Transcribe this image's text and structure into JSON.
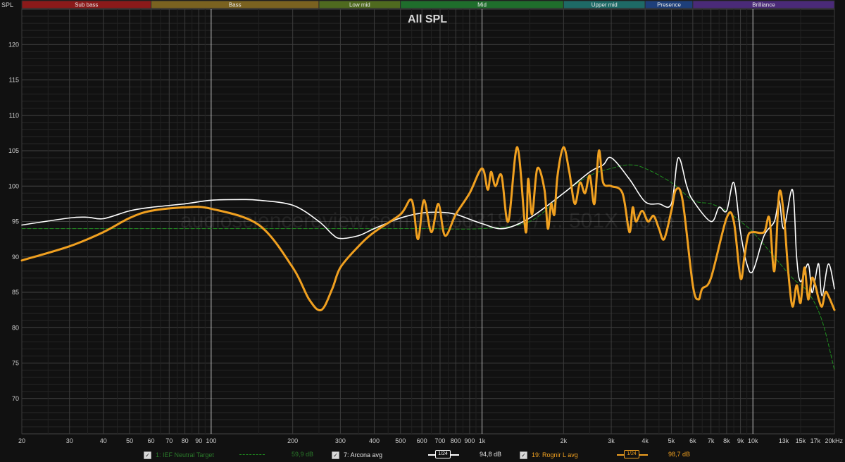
{
  "chart_data": {
    "type": "line",
    "title": "All SPL",
    "ylabel": "SPL",
    "xlim": [
      20,
      20000
    ],
    "ylim": [
      65,
      125
    ],
    "x_scale": "log",
    "grid": true,
    "watermark": "audiosciencereview.com IEC60318-4 / ... 501X clone",
    "bands": [
      {
        "name": "Sub bass",
        "from": 20,
        "to": 60,
        "color": "#8b1a1a"
      },
      {
        "name": "Bass",
        "from": 60,
        "to": 250,
        "color": "#7a6220"
      },
      {
        "name": "Low mid",
        "from": 250,
        "to": 500,
        "color": "#4f6a1f"
      },
      {
        "name": "Mid",
        "from": 500,
        "to": 2000,
        "color": "#1f6e2c"
      },
      {
        "name": "Upper mid",
        "from": 2000,
        "to": 4000,
        "color": "#1e6a66"
      },
      {
        "name": "Presence",
        "from": 4000,
        "to": 6000,
        "color": "#1e3f7a"
      },
      {
        "name": "Brilliance",
        "from": 6000,
        "to": 20000,
        "color": "#4a2a78"
      }
    ],
    "y_ticks": [
      70,
      75,
      80,
      85,
      90,
      95,
      100,
      105,
      110,
      115,
      120
    ],
    "x_ticks": [
      {
        "v": 20,
        "label": "20"
      },
      {
        "v": 30,
        "label": "30"
      },
      {
        "v": 40,
        "label": "40"
      },
      {
        "v": 50,
        "label": "50"
      },
      {
        "v": 60,
        "label": "60"
      },
      {
        "v": 70,
        "label": "70"
      },
      {
        "v": 80,
        "label": "80"
      },
      {
        "v": 90,
        "label": "90"
      },
      {
        "v": 100,
        "label": "100"
      },
      {
        "v": 200,
        "label": "200"
      },
      {
        "v": 300,
        "label": "300"
      },
      {
        "v": 400,
        "label": "400"
      },
      {
        "v": 500,
        "label": "500"
      },
      {
        "v": 600,
        "label": "600"
      },
      {
        "v": 700,
        "label": "700"
      },
      {
        "v": 800,
        "label": "800"
      },
      {
        "v": 900,
        "label": "900"
      },
      {
        "v": 1000,
        "label": "1k"
      },
      {
        "v": 2000,
        "label": "2k"
      },
      {
        "v": 3000,
        "label": "3k"
      },
      {
        "v": 4000,
        "label": "4k"
      },
      {
        "v": 5000,
        "label": "5k"
      },
      {
        "v": 6000,
        "label": "6k"
      },
      {
        "v": 7000,
        "label": "7k"
      },
      {
        "v": 8000,
        "label": "8k"
      },
      {
        "v": 9000,
        "label": "9k"
      },
      {
        "v": 10000,
        "label": "10k"
      },
      {
        "v": 13000,
        "label": "13k"
      },
      {
        "v": 15000,
        "label": "15k"
      },
      {
        "v": 17000,
        "label": "17k"
      },
      {
        "v": 20000,
        "label": "20kHz"
      }
    ],
    "series": [
      {
        "name": "1: IEF Neutral Target",
        "color": "#1f8f1f",
        "dashed": true,
        "x": [
          20,
          100,
          300,
          600,
          1000,
          1500,
          2000,
          2500,
          3000,
          3500,
          4000,
          5000,
          6000,
          7000,
          8000,
          9000,
          10000,
          12000,
          14000,
          16000,
          18000,
          20000
        ],
        "y": [
          94,
          94,
          94,
          94,
          94,
          95,
          99,
          101.5,
          102.5,
          103,
          102.5,
          100.5,
          98,
          97.5,
          96.5,
          95,
          93.5,
          90,
          87,
          85,
          81,
          74
        ]
      },
      {
        "name": "7: Arcona avg",
        "color": "#ffffff",
        "dashed": false,
        "x": [
          20,
          30,
          35,
          40,
          50,
          60,
          80,
          100,
          130,
          150,
          200,
          250,
          280,
          300,
          350,
          400,
          500,
          600,
          700,
          800,
          1000,
          1200,
          1500,
          2000,
          2500,
          2800,
          3000,
          3500,
          4000,
          4500,
          5000,
          5300,
          5700,
          6000,
          7000,
          7500,
          8000,
          8500,
          9000,
          9500,
          10000,
          11000,
          12000,
          12500,
          13000,
          14000,
          14500,
          15000,
          16000,
          16500,
          17000,
          17500,
          18000,
          19000,
          20000
        ],
        "y": [
          94.5,
          95.5,
          95.6,
          95.4,
          96.5,
          97.0,
          97.5,
          98.0,
          98.1,
          98.0,
          97.3,
          95.0,
          93.2,
          92.6,
          93.0,
          94.0,
          95.5,
          96.2,
          96.3,
          96.0,
          94.7,
          94.0,
          95.5,
          99.0,
          102.0,
          103.0,
          104.0,
          101.0,
          97.8,
          97.5,
          97.5,
          104.0,
          100.0,
          98.0,
          95.0,
          97.0,
          96.5,
          100.5,
          93.5,
          89.0,
          88.0,
          93.0,
          95.0,
          98.0,
          94.0,
          99.5,
          90.0,
          86.5,
          89.0,
          85.0,
          87.0,
          89.0,
          84.5,
          89.0,
          85.5
        ]
      },
      {
        "name": "19: Rognir L avg",
        "color": "#f0a020",
        "dashed": false,
        "x": [
          20,
          30,
          40,
          50,
          60,
          80,
          100,
          150,
          200,
          230,
          255,
          280,
          300,
          350,
          400,
          500,
          550,
          580,
          610,
          650,
          690,
          730,
          800,
          900,
          1000,
          1050,
          1080,
          1120,
          1180,
          1250,
          1350,
          1450,
          1480,
          1530,
          1600,
          1700,
          1750,
          1800,
          1850,
          1900,
          2000,
          2100,
          2200,
          2300,
          2400,
          2500,
          2600,
          2700,
          2800,
          3000,
          3300,
          3500,
          3600,
          3700,
          3900,
          4100,
          4300,
          4500,
          4700,
          5000,
          5200,
          5500,
          6000,
          6300,
          6500,
          7000,
          8000,
          8500,
          9000,
          9300,
          9600,
          10000,
          11000,
          11500,
          12000,
          12500,
          13000,
          13500,
          14000,
          14500,
          15000,
          15500,
          16000,
          16500,
          17000,
          17500,
          18000,
          18500,
          19000,
          20000
        ],
        "y": [
          89.5,
          91.5,
          93.5,
          95.5,
          96.5,
          97.0,
          96.8,
          94.5,
          88.5,
          84.0,
          82.5,
          85.5,
          88.5,
          91.5,
          93.5,
          96.0,
          98.0,
          92.5,
          98.0,
          93.5,
          97.5,
          93.0,
          96.0,
          99.0,
          102.5,
          99.5,
          102.0,
          100.0,
          101.5,
          95.0,
          105.5,
          93.5,
          101.0,
          96.0,
          102.5,
          99.5,
          94.0,
          97.5,
          96.0,
          101.5,
          105.5,
          102.0,
          97.5,
          100.5,
          99.0,
          101.5,
          97.5,
          105.0,
          100.5,
          100.0,
          99.0,
          93.5,
          97.0,
          95.0,
          96.5,
          95.0,
          95.8,
          94.0,
          92.5,
          96.5,
          99.5,
          98.0,
          86.0,
          84.0,
          85.5,
          87.0,
          95.5,
          95.0,
          87.0,
          90.0,
          93.0,
          93.5,
          93.5,
          95.5,
          88.0,
          99.0,
          96.0,
          88.0,
          83.0,
          86.0,
          83.5,
          88.5,
          84.0,
          87.0,
          86.0,
          84.0,
          83.0,
          85.0,
          84.5,
          82.5
        ]
      }
    ]
  },
  "legend": {
    "items": [
      {
        "label": "1: IEF Neutral Target",
        "value": "59,9 dB",
        "box": ""
      },
      {
        "label": "7: Arcona avg",
        "value": "94,8 dB",
        "box": "1/24"
      },
      {
        "label": "19: Rognir L avg",
        "value": "98,7 dB",
        "box": "1/24"
      }
    ]
  }
}
